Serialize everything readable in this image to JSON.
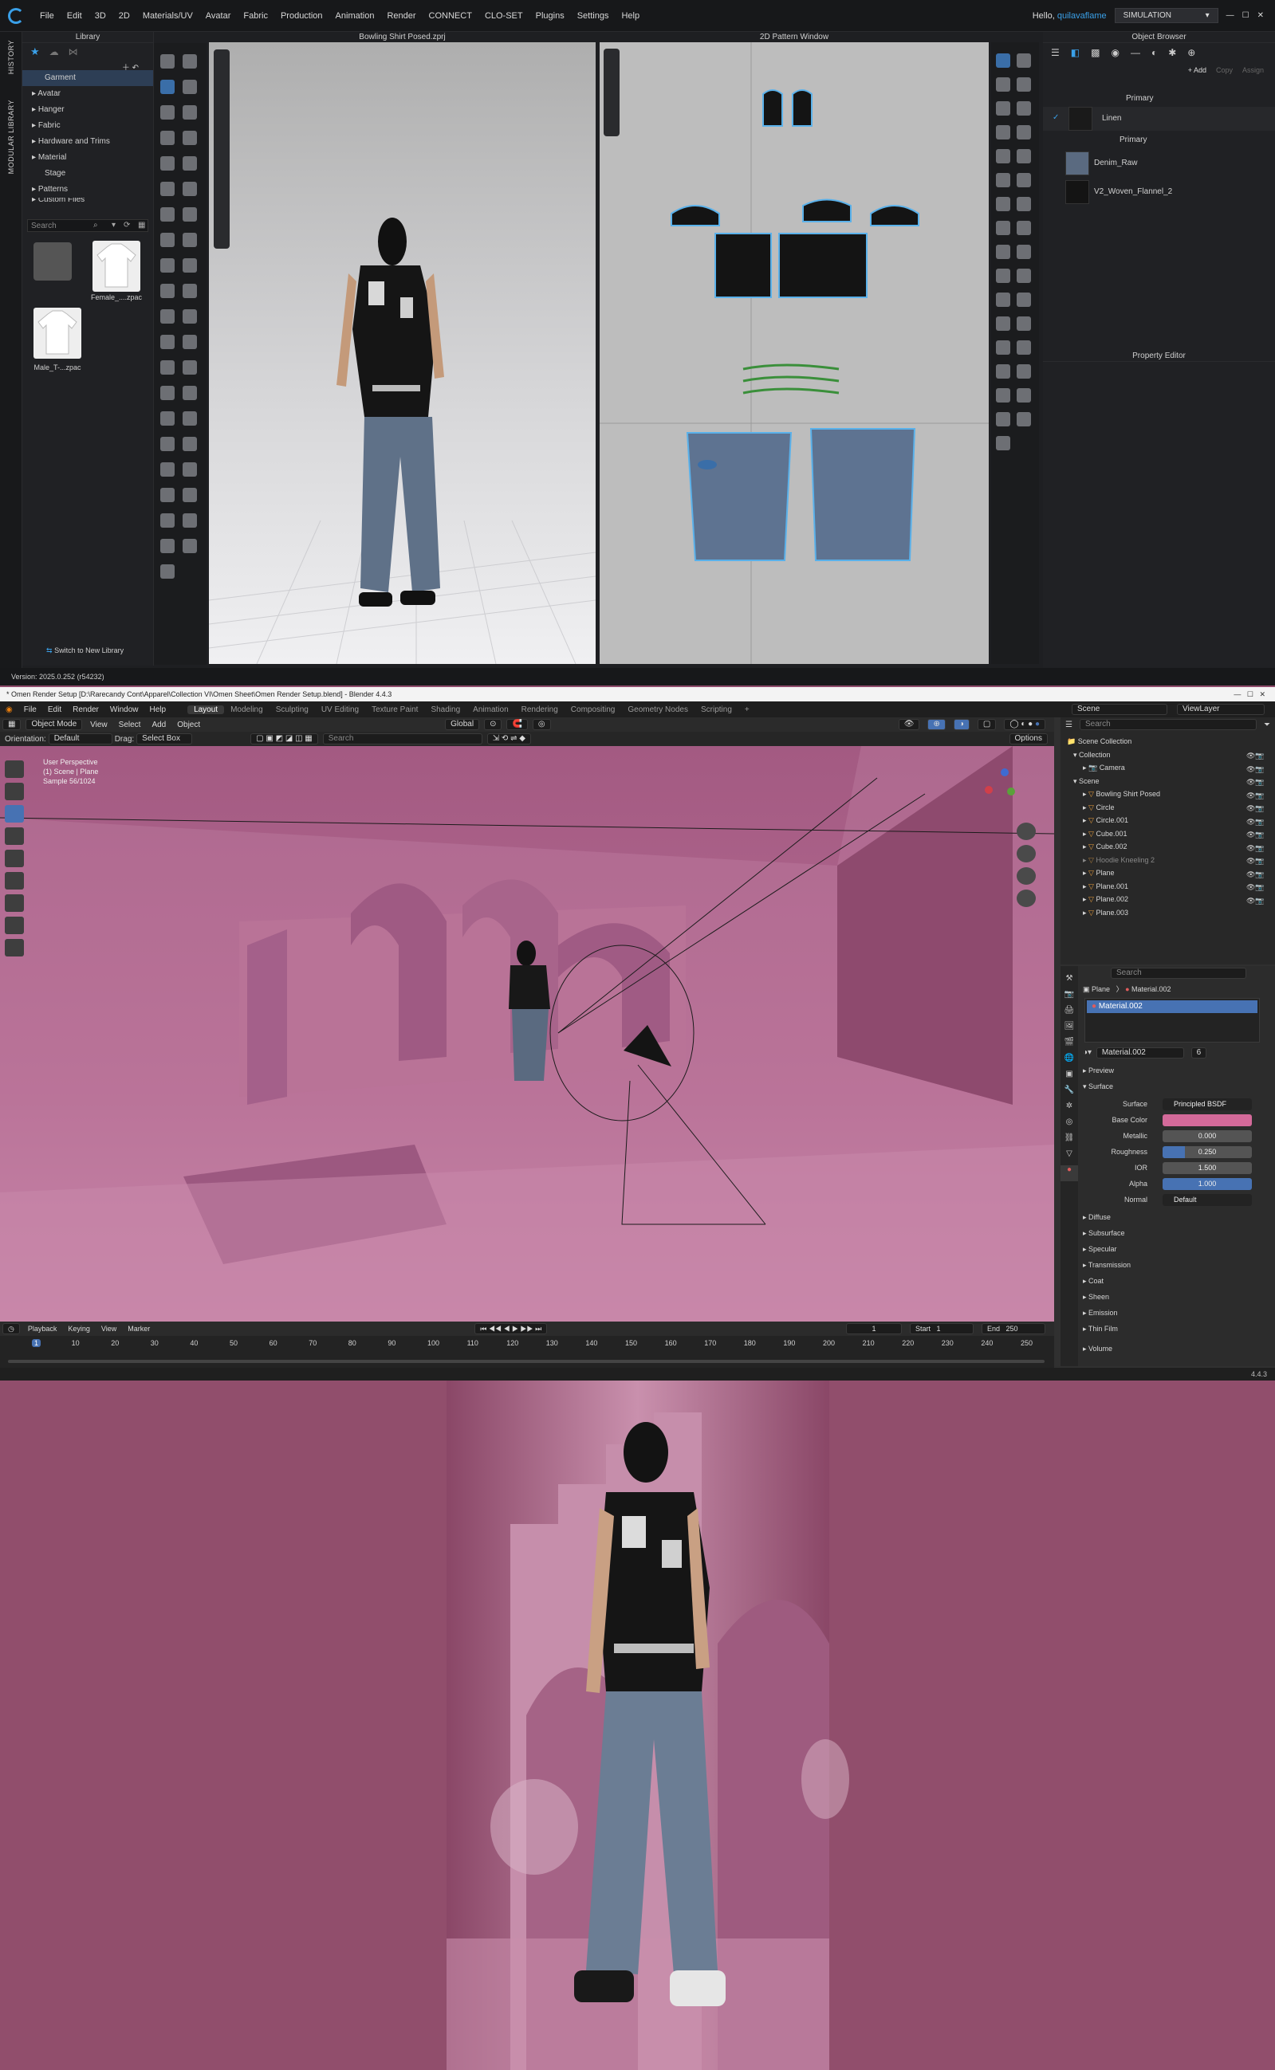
{
  "clo": {
    "menu": [
      "File",
      "Edit",
      "3D",
      "2D",
      "Materials/UV",
      "Avatar",
      "Fabric",
      "Production",
      "Animation",
      "Render",
      "CONNECT",
      "CLO-SET",
      "Plugins",
      "Settings",
      "Help"
    ],
    "greeting": "Hello,",
    "username": "quilavaflame",
    "mode": "SIMULATION",
    "left_strip": {
      "history": "HISTORY",
      "modular": "MODULAR LIBRARY"
    },
    "library": {
      "title": "Library",
      "items": [
        "Garment",
        "Avatar",
        "Hanger",
        "Fabric",
        "Hardware and Trims",
        "Material",
        "Stage",
        "Patterns",
        "Custom Files"
      ],
      "search_placeholder": "Search",
      "thumbs": [
        "Female_....zpac",
        "Male_T-...zpac"
      ],
      "switch": "Switch to New Library"
    },
    "viewport3d_title": "Bowling Shirt Posed.zprj",
    "pattern_title": "2D Pattern Window",
    "object_browser": {
      "title": "Object Browser",
      "add": "+ Add",
      "copy": "Copy",
      "assign": "Assign",
      "group1": "Primary",
      "fabric1": "Linen",
      "group2": "Primary",
      "fabrics": [
        "Denim_Raw",
        "V2_Woven_Flannel_2"
      ]
    },
    "property_editor": "Property Editor",
    "version": "Version: 2025.0.252 (r54232)"
  },
  "blender": {
    "title": "* Omen Render Setup [D:\\Rarecandy Cont\\Apparel\\Collection VI\\Omen Sheet\\Omen Render Setup.blend] - Blender 4.4.3",
    "menu": [
      "File",
      "Edit",
      "Render",
      "Window",
      "Help"
    ],
    "workspaces": [
      "Layout",
      "Modeling",
      "Sculpting",
      "UV Editing",
      "Texture Paint",
      "Shading",
      "Animation",
      "Rendering",
      "Compositing",
      "Geometry Nodes",
      "Scripting"
    ],
    "scene": "Scene",
    "viewlayer": "ViewLayer",
    "header": {
      "mode": "Object Mode",
      "view": "View",
      "select": "Select",
      "add": "Add",
      "object": "Object",
      "global": "Global"
    },
    "header2": {
      "orientation_label": "Orientation:",
      "orientation": "Default",
      "drag_label": "Drag:",
      "drag": "Select Box",
      "search": "Search",
      "options": "Options"
    },
    "viewport_info": [
      "User Perspective",
      "(1) Scene | Plane",
      "Sample 56/1024"
    ],
    "outliner": {
      "search": "Search",
      "rows": [
        "Scene Collection",
        "Collection",
        "Camera",
        "Scene",
        "Bowling Shirt Posed",
        "Circle",
        "Circle.001",
        "Cube.001",
        "Cube.002",
        "Hoodie Kneeling 2",
        "Plane",
        "Plane.001",
        "Plane.002",
        "Plane.003"
      ]
    },
    "props": {
      "search": "Search",
      "object": "Plane",
      "material": "Material.002",
      "slot": "Material.002",
      "mat_name": "Material.002",
      "users": "6",
      "preview": "Preview",
      "surface": "Surface",
      "fields": [
        {
          "label": "Surface",
          "value": "Principled BSDF"
        },
        {
          "label": "Base Color",
          "value": ""
        },
        {
          "label": "Metallic",
          "value": "0.000"
        },
        {
          "label": "Roughness",
          "value": "0.250"
        },
        {
          "label": "IOR",
          "value": "1.500"
        },
        {
          "label": "Alpha",
          "value": "1.000"
        },
        {
          "label": "Normal",
          "value": "Default"
        }
      ],
      "sections": [
        "Diffuse",
        "Subsurface",
        "Specular",
        "Transmission",
        "Coat",
        "Sheen",
        "Emission",
        "Thin Film",
        "Volume"
      ],
      "base_color": "#d46a9a"
    },
    "timeline": {
      "playback": "Playback",
      "keying": "Keying",
      "view": "View",
      "marker": "Marker",
      "current": "1",
      "start_label": "Start",
      "start": "1",
      "end_label": "End",
      "end": "250",
      "ticks": [
        "1",
        "10",
        "20",
        "30",
        "40",
        "50",
        "60",
        "70",
        "80",
        "90",
        "100",
        "110",
        "120",
        "130",
        "140",
        "150",
        "160",
        "170",
        "180",
        "190",
        "200",
        "210",
        "220",
        "230",
        "240",
        "250"
      ]
    },
    "version": "4.4.3"
  },
  "colors": {
    "accent": "#3aa0e8",
    "pink_bg": "#914e6c",
    "blender_blue": "#4772b3"
  }
}
